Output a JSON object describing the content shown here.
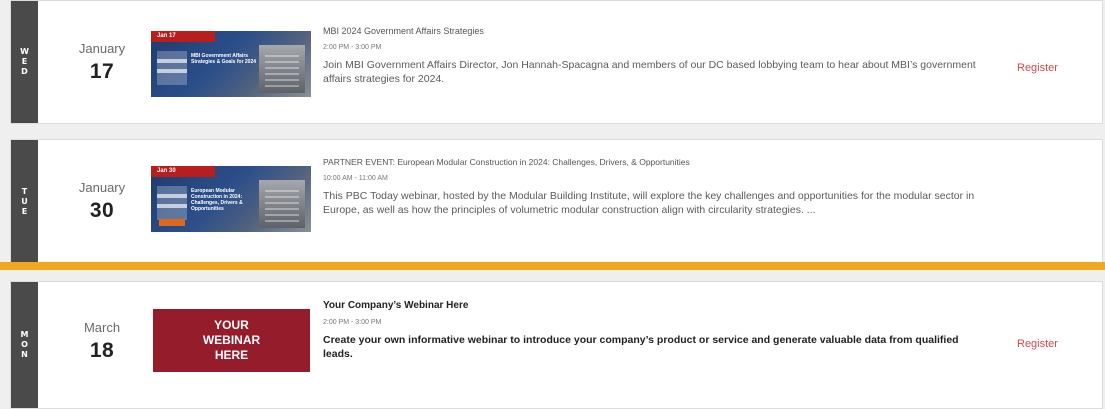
{
  "accent_color": "#f0a81d",
  "events": [
    {
      "day_letters": [
        "W",
        "E",
        "D"
      ],
      "month": "January",
      "day": "17",
      "thumbnail_tag": "Jan 17",
      "thumbnail_caption": "MBI Government Affairs Strategies & Goals for 2024",
      "title": "MBI 2024 Government Affairs Strategies",
      "time": "2:00 PM - 3:00 PM",
      "description": "Join MBI Government Affairs Director, Jon Hannah-Spacagna and members of our DC based lobbying team to hear about MBI’s government affairs strategies for 2024.",
      "register_label": "Register"
    },
    {
      "day_letters": [
        "T",
        "U",
        "E"
      ],
      "month": "January",
      "day": "30",
      "thumbnail_tag": "Jan 30",
      "thumbnail_caption": "European Modular Construction in 2024: Challenges, Drivers & Opportunities",
      "title": "PARTNER EVENT: European Modular Construction in 2024: Challenges, Drivers, & Opportunities",
      "time": "10:00 AM - 11:00 AM",
      "description": "This PBC Today webinar, hosted by the Modular Building Institute, will explore the key challenges and opportunities for the modular sector in Europe, as well as how the principles of volumetric modular construction align with circularity strategies. ..."
    },
    {
      "day_letters": [
        "M",
        "O",
        "N"
      ],
      "month": "March",
      "day": "18",
      "thumbnail_lines": [
        "YOUR",
        "WEBINAR",
        "HERE"
      ],
      "title": "Your Company’s Webinar Here",
      "time": "2:00 PM - 3:00 PM",
      "description": "Create your own informative webinar to introduce your company’s product or service and generate valuable data from qualified leads.",
      "register_label": "Register"
    }
  ]
}
